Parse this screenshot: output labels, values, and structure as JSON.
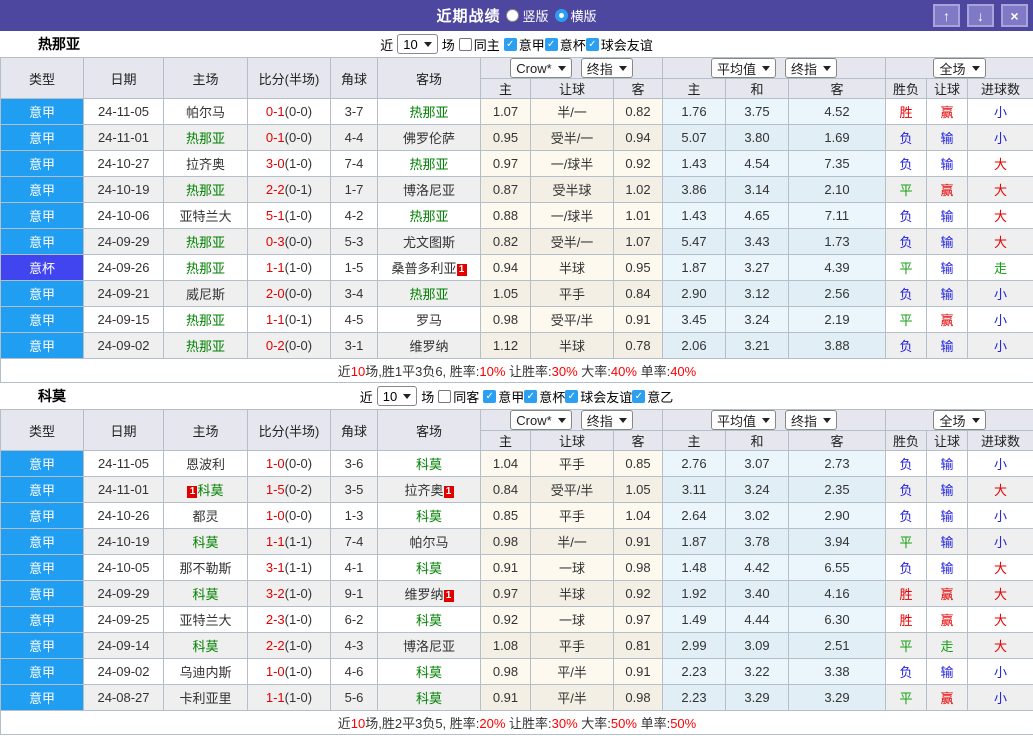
{
  "titlebar": {
    "title": "近期战绩",
    "vertical_label": "竖版",
    "horizontal_label": "横版",
    "selected_layout": "横版",
    "buttons": {
      "up": "↑",
      "down": "↓",
      "close": "×"
    }
  },
  "table_headers": {
    "cols": [
      "类型",
      "日期",
      "主场",
      "比分(半场)",
      "角球",
      "客场"
    ],
    "odds_selects": [
      "Crow*",
      "终指"
    ],
    "avg_selects": [
      "平均值",
      "终指"
    ],
    "full_selects": [
      "全场"
    ],
    "sub": [
      "主",
      "让球",
      "客",
      "主",
      "和",
      "客",
      "胜负",
      "让球",
      "进球数"
    ]
  },
  "colors": {
    "titlebar": "#4e479f",
    "league_type_blue": "#1f9ef2",
    "cup_type_blue": "#4145ef",
    "team_highlight_green": "#008000",
    "score_red": "#e60000",
    "win_red": "#e60000",
    "draw_green": "#12a012",
    "lose_blue": "#2222dd"
  },
  "sections": [
    {
      "team": "热那亚",
      "filter": {
        "near_label": "近",
        "count": "10",
        "games_label": "场",
        "same_label": "同主",
        "same_checked": false,
        "leagues": [
          "意甲",
          "意杯",
          "球会友谊"
        ]
      },
      "rows": [
        {
          "type": "意甲",
          "cup": false,
          "date": "24-11-05",
          "home": {
            "name": "帕尔马",
            "hl": false,
            "badge": null
          },
          "score": "0-1",
          "half": "(0-0)",
          "corners": "3-7",
          "away": {
            "name": "热那亚",
            "hl": true,
            "badge": null
          },
          "odds": [
            "1.07",
            "半/一",
            "0.82"
          ],
          "avg": [
            "1.76",
            "3.75",
            "4.52"
          ],
          "res": [
            [
              "胜",
              "win"
            ],
            [
              "赢",
              "win"
            ],
            [
              "小",
              "lose"
            ]
          ]
        },
        {
          "type": "意甲",
          "cup": false,
          "date": "24-11-01",
          "home": {
            "name": "热那亚",
            "hl": true,
            "badge": null
          },
          "score": "0-1",
          "half": "(0-0)",
          "corners": "4-4",
          "away": {
            "name": "佛罗伦萨",
            "hl": false,
            "badge": null
          },
          "odds": [
            "0.95",
            "受半/一",
            "0.94"
          ],
          "avg": [
            "5.07",
            "3.80",
            "1.69"
          ],
          "res": [
            [
              "负",
              "lose"
            ],
            [
              "输",
              "lose"
            ],
            [
              "小",
              "lose"
            ]
          ]
        },
        {
          "type": "意甲",
          "cup": false,
          "date": "24-10-27",
          "home": {
            "name": "拉齐奥",
            "hl": false,
            "badge": null
          },
          "score": "3-0",
          "half": "(1-0)",
          "corners": "7-4",
          "away": {
            "name": "热那亚",
            "hl": true,
            "badge": null
          },
          "odds": [
            "0.97",
            "一/球半",
            "0.92"
          ],
          "avg": [
            "1.43",
            "4.54",
            "7.35"
          ],
          "res": [
            [
              "负",
              "lose"
            ],
            [
              "输",
              "lose"
            ],
            [
              "大",
              "win"
            ]
          ]
        },
        {
          "type": "意甲",
          "cup": false,
          "date": "24-10-19",
          "home": {
            "name": "热那亚",
            "hl": true,
            "badge": null
          },
          "score": "2-2",
          "half": "(0-1)",
          "corners": "1-7",
          "away": {
            "name": "博洛尼亚",
            "hl": false,
            "badge": null
          },
          "odds": [
            "0.87",
            "受半球",
            "1.02"
          ],
          "avg": [
            "3.86",
            "3.14",
            "2.10"
          ],
          "res": [
            [
              "平",
              "draw"
            ],
            [
              "赢",
              "win"
            ],
            [
              "大",
              "win"
            ]
          ]
        },
        {
          "type": "意甲",
          "cup": false,
          "date": "24-10-06",
          "home": {
            "name": "亚特兰大",
            "hl": false,
            "badge": null
          },
          "score": "5-1",
          "half": "(1-0)",
          "corners": "4-2",
          "away": {
            "name": "热那亚",
            "hl": true,
            "badge": null
          },
          "odds": [
            "0.88",
            "一/球半",
            "1.01"
          ],
          "avg": [
            "1.43",
            "4.65",
            "7.11"
          ],
          "res": [
            [
              "负",
              "lose"
            ],
            [
              "输",
              "lose"
            ],
            [
              "大",
              "win"
            ]
          ]
        },
        {
          "type": "意甲",
          "cup": false,
          "date": "24-09-29",
          "home": {
            "name": "热那亚",
            "hl": true,
            "badge": null
          },
          "score": "0-3",
          "half": "(0-0)",
          "corners": "5-3",
          "away": {
            "name": "尤文图斯",
            "hl": false,
            "badge": null
          },
          "odds": [
            "0.82",
            "受半/一",
            "1.07"
          ],
          "avg": [
            "5.47",
            "3.43",
            "1.73"
          ],
          "res": [
            [
              "负",
              "lose"
            ],
            [
              "输",
              "lose"
            ],
            [
              "大",
              "win"
            ]
          ]
        },
        {
          "type": "意杯",
          "cup": true,
          "date": "24-09-26",
          "home": {
            "name": "热那亚",
            "hl": true,
            "badge": null
          },
          "score": "1-1",
          "half": "(1-0)",
          "corners": "1-5",
          "away": {
            "name": "桑普多利亚",
            "hl": false,
            "badge": "after"
          },
          "odds": [
            "0.94",
            "半球",
            "0.95"
          ],
          "avg": [
            "1.87",
            "3.27",
            "4.39"
          ],
          "res": [
            [
              "平",
              "draw"
            ],
            [
              "输",
              "lose"
            ],
            [
              "走",
              "draw"
            ]
          ]
        },
        {
          "type": "意甲",
          "cup": false,
          "date": "24-09-21",
          "home": {
            "name": "威尼斯",
            "hl": false,
            "badge": null
          },
          "score": "2-0",
          "half": "(0-0)",
          "corners": "3-4",
          "away": {
            "name": "热那亚",
            "hl": true,
            "badge": null
          },
          "odds": [
            "1.05",
            "平手",
            "0.84"
          ],
          "avg": [
            "2.90",
            "3.12",
            "2.56"
          ],
          "res": [
            [
              "负",
              "lose"
            ],
            [
              "输",
              "lose"
            ],
            [
              "小",
              "lose"
            ]
          ]
        },
        {
          "type": "意甲",
          "cup": false,
          "date": "24-09-15",
          "home": {
            "name": "热那亚",
            "hl": true,
            "badge": null
          },
          "score": "1-1",
          "half": "(0-1)",
          "corners": "4-5",
          "away": {
            "name": "罗马",
            "hl": false,
            "badge": null
          },
          "odds": [
            "0.98",
            "受平/半",
            "0.91"
          ],
          "avg": [
            "3.45",
            "3.24",
            "2.19"
          ],
          "res": [
            [
              "平",
              "draw"
            ],
            [
              "赢",
              "win"
            ],
            [
              "小",
              "lose"
            ]
          ]
        },
        {
          "type": "意甲",
          "cup": false,
          "date": "24-09-02",
          "home": {
            "name": "热那亚",
            "hl": true,
            "badge": null
          },
          "score": "0-2",
          "half": "(0-0)",
          "corners": "3-1",
          "away": {
            "name": "维罗纳",
            "hl": false,
            "badge": null
          },
          "odds": [
            "1.12",
            "半球",
            "0.78"
          ],
          "avg": [
            "2.06",
            "3.21",
            "3.88"
          ],
          "res": [
            [
              "负",
              "lose"
            ],
            [
              "输",
              "lose"
            ],
            [
              "小",
              "lose"
            ]
          ]
        }
      ],
      "summary": [
        [
          "近",
          false
        ],
        [
          "10",
          true
        ],
        [
          "场,胜1平3负6, 胜率:",
          false
        ],
        [
          "10%",
          true
        ],
        [
          " 让胜率:",
          false
        ],
        [
          "30%",
          true
        ],
        [
          " 大率:",
          false
        ],
        [
          "40%",
          true
        ],
        [
          " 单率:",
          false
        ],
        [
          "40%",
          true
        ]
      ]
    },
    {
      "team": "科莫",
      "filter": {
        "near_label": "近",
        "count": "10",
        "games_label": "场",
        "same_label": "同客",
        "same_checked": false,
        "leagues": [
          "意甲",
          "意杯",
          "球会友谊",
          "意乙"
        ]
      },
      "rows": [
        {
          "type": "意甲",
          "cup": false,
          "date": "24-11-05",
          "home": {
            "name": "恩波利",
            "hl": false,
            "badge": null
          },
          "score": "1-0",
          "half": "(0-0)",
          "corners": "3-6",
          "away": {
            "name": "科莫",
            "hl": true,
            "badge": null
          },
          "odds": [
            "1.04",
            "平手",
            "0.85"
          ],
          "avg": [
            "2.76",
            "3.07",
            "2.73"
          ],
          "res": [
            [
              "负",
              "lose"
            ],
            [
              "输",
              "lose"
            ],
            [
              "小",
              "lose"
            ]
          ]
        },
        {
          "type": "意甲",
          "cup": false,
          "date": "24-11-01",
          "home": {
            "name": "科莫",
            "hl": true,
            "badge": "before"
          },
          "score": "1-5",
          "half": "(0-2)",
          "corners": "3-5",
          "away": {
            "name": "拉齐奥",
            "hl": false,
            "badge": "after"
          },
          "odds": [
            "0.84",
            "受平/半",
            "1.05"
          ],
          "avg": [
            "3.11",
            "3.24",
            "2.35"
          ],
          "res": [
            [
              "负",
              "lose"
            ],
            [
              "输",
              "lose"
            ],
            [
              "大",
              "win"
            ]
          ]
        },
        {
          "type": "意甲",
          "cup": false,
          "date": "24-10-26",
          "home": {
            "name": "都灵",
            "hl": false,
            "badge": null
          },
          "score": "1-0",
          "half": "(0-0)",
          "corners": "1-3",
          "away": {
            "name": "科莫",
            "hl": true,
            "badge": null
          },
          "odds": [
            "0.85",
            "平手",
            "1.04"
          ],
          "avg": [
            "2.64",
            "3.02",
            "2.90"
          ],
          "res": [
            [
              "负",
              "lose"
            ],
            [
              "输",
              "lose"
            ],
            [
              "小",
              "lose"
            ]
          ]
        },
        {
          "type": "意甲",
          "cup": false,
          "date": "24-10-19",
          "home": {
            "name": "科莫",
            "hl": true,
            "badge": null
          },
          "score": "1-1",
          "half": "(1-1)",
          "corners": "7-4",
          "away": {
            "name": "帕尔马",
            "hl": false,
            "badge": null
          },
          "odds": [
            "0.98",
            "半/一",
            "0.91"
          ],
          "avg": [
            "1.87",
            "3.78",
            "3.94"
          ],
          "res": [
            [
              "平",
              "draw"
            ],
            [
              "输",
              "lose"
            ],
            [
              "小",
              "lose"
            ]
          ]
        },
        {
          "type": "意甲",
          "cup": false,
          "date": "24-10-05",
          "home": {
            "name": "那不勒斯",
            "hl": false,
            "badge": null
          },
          "score": "3-1",
          "half": "(1-1)",
          "corners": "4-1",
          "away": {
            "name": "科莫",
            "hl": true,
            "badge": null
          },
          "odds": [
            "0.91",
            "一球",
            "0.98"
          ],
          "avg": [
            "1.48",
            "4.42",
            "6.55"
          ],
          "res": [
            [
              "负",
              "lose"
            ],
            [
              "输",
              "lose"
            ],
            [
              "大",
              "win"
            ]
          ]
        },
        {
          "type": "意甲",
          "cup": false,
          "date": "24-09-29",
          "home": {
            "name": "科莫",
            "hl": true,
            "badge": null
          },
          "score": "3-2",
          "half": "(1-0)",
          "corners": "9-1",
          "away": {
            "name": "维罗纳",
            "hl": false,
            "badge": "after"
          },
          "odds": [
            "0.97",
            "半球",
            "0.92"
          ],
          "avg": [
            "1.92",
            "3.40",
            "4.16"
          ],
          "res": [
            [
              "胜",
              "win"
            ],
            [
              "赢",
              "win"
            ],
            [
              "大",
              "win"
            ]
          ]
        },
        {
          "type": "意甲",
          "cup": false,
          "date": "24-09-25",
          "home": {
            "name": "亚特兰大",
            "hl": false,
            "badge": null
          },
          "score": "2-3",
          "half": "(1-0)",
          "corners": "6-2",
          "away": {
            "name": "科莫",
            "hl": true,
            "badge": null
          },
          "odds": [
            "0.92",
            "一球",
            "0.97"
          ],
          "avg": [
            "1.49",
            "4.44",
            "6.30"
          ],
          "res": [
            [
              "胜",
              "win"
            ],
            [
              "赢",
              "win"
            ],
            [
              "大",
              "win"
            ]
          ]
        },
        {
          "type": "意甲",
          "cup": false,
          "date": "24-09-14",
          "home": {
            "name": "科莫",
            "hl": true,
            "badge": null
          },
          "score": "2-2",
          "half": "(1-0)",
          "corners": "4-3",
          "away": {
            "name": "博洛尼亚",
            "hl": false,
            "badge": null
          },
          "odds": [
            "1.08",
            "平手",
            "0.81"
          ],
          "avg": [
            "2.99",
            "3.09",
            "2.51"
          ],
          "res": [
            [
              "平",
              "draw"
            ],
            [
              "走",
              "draw"
            ],
            [
              "大",
              "win"
            ]
          ]
        },
        {
          "type": "意甲",
          "cup": false,
          "date": "24-09-02",
          "home": {
            "name": "乌迪内斯",
            "hl": false,
            "badge": null
          },
          "score": "1-0",
          "half": "(1-0)",
          "corners": "4-6",
          "away": {
            "name": "科莫",
            "hl": true,
            "badge": null
          },
          "odds": [
            "0.98",
            "平/半",
            "0.91"
          ],
          "avg": [
            "2.23",
            "3.22",
            "3.38"
          ],
          "res": [
            [
              "负",
              "lose"
            ],
            [
              "输",
              "lose"
            ],
            [
              "小",
              "lose"
            ]
          ]
        },
        {
          "type": "意甲",
          "cup": false,
          "date": "24-08-27",
          "home": {
            "name": "卡利亚里",
            "hl": false,
            "badge": null
          },
          "score": "1-1",
          "half": "(1-0)",
          "corners": "5-6",
          "away": {
            "name": "科莫",
            "hl": true,
            "badge": null
          },
          "odds": [
            "0.91",
            "平/半",
            "0.98"
          ],
          "avg": [
            "2.23",
            "3.29",
            "3.29"
          ],
          "res": [
            [
              "平",
              "draw"
            ],
            [
              "赢",
              "win"
            ],
            [
              "小",
              "lose"
            ]
          ]
        }
      ],
      "summary": [
        [
          "近",
          false
        ],
        [
          "10",
          true
        ],
        [
          "场,胜2平3负5, 胜率:",
          false
        ],
        [
          "20%",
          true
        ],
        [
          " 让胜率:",
          false
        ],
        [
          "30%",
          true
        ],
        [
          " 大率:",
          false
        ],
        [
          "50%",
          true
        ],
        [
          " 单率:",
          false
        ],
        [
          "50%",
          true
        ]
      ]
    }
  ]
}
